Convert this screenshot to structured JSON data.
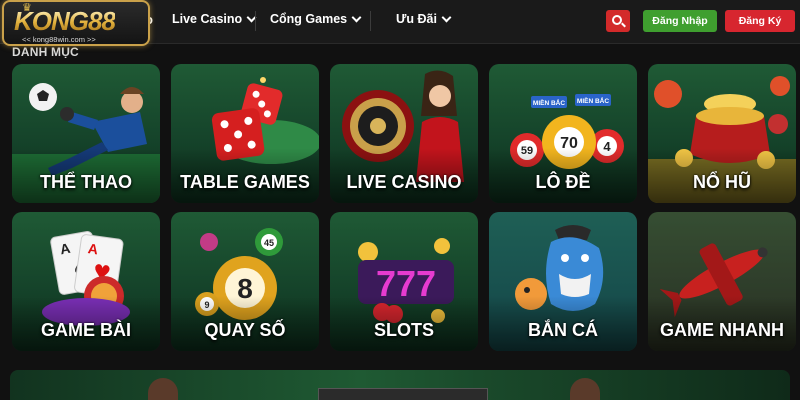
{
  "brand": {
    "logo_text": "KONG88",
    "logo_url": "<< kong88win.com >>"
  },
  "nav": {
    "partial_item": "o",
    "items": [
      {
        "label": "Live Casino"
      },
      {
        "label": "Cổng Games"
      },
      {
        "label": "Ưu Đãi"
      }
    ]
  },
  "actions": {
    "search_icon": "search-icon",
    "login_label": "Đăng Nhập",
    "register_label": "Đăng Ký"
  },
  "colors": {
    "accent_red": "#d32a2a",
    "login_green": "#3f9f2f",
    "logo_gold": "#caa14a"
  },
  "section": {
    "title": "DANH MỤC"
  },
  "categories": [
    {
      "label": "THỂ THAO"
    },
    {
      "label": "TABLE GAMES"
    },
    {
      "label": "LIVE CASINO"
    },
    {
      "label": "LÔ ĐỀ"
    },
    {
      "label": "NỔ HŨ"
    },
    {
      "label": "GAME BÀI"
    },
    {
      "label": "QUAY SỐ"
    },
    {
      "label": "SLOTS"
    },
    {
      "label": "BẮN CÁ"
    },
    {
      "label": "GAME NHANH"
    }
  ],
  "art_text": {
    "lode_tag1": "MIỀN BẮC",
    "lode_tag2": "MIỀN BẮC",
    "lode_ball_main": "70",
    "lode_ball_left": "59",
    "lode_ball_right": "4",
    "quayso_main": "8",
    "quayso_top": "45",
    "quayso_left": "9",
    "slots_reels": "777",
    "card_letter": "A"
  }
}
